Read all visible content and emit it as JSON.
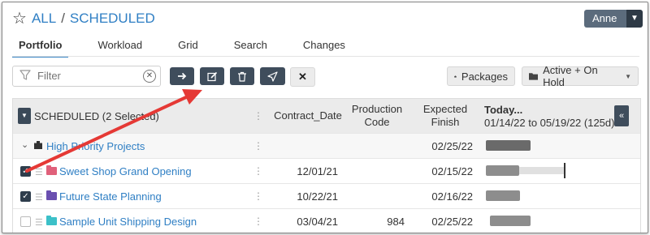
{
  "breadcrumb": {
    "root": "ALL",
    "separator": "/",
    "current": "SCHEDULED"
  },
  "user": {
    "name": "Anne"
  },
  "tabs": [
    "Portfolio",
    "Workload",
    "Grid",
    "Search",
    "Changes"
  ],
  "active_tab": "Portfolio",
  "filter": {
    "placeholder": "Filter"
  },
  "toolbar": {
    "buttons": [
      "move-arrow-icon",
      "edit-icon",
      "trash-icon",
      "send-icon",
      "close-icon"
    ],
    "packages_label": "Packages",
    "status_filter_label": "Active + On Hold"
  },
  "grid": {
    "selection_label": "SCHEDULED (2 Selected)",
    "headers": {
      "contract_date": "Contract_Date",
      "production_code_1": "Production",
      "production_code_2": "Code",
      "expected_finish_1": "Expected",
      "expected_finish_2": "Finish",
      "timeline_title": "Today...",
      "timeline_range": "01/14/22 to 05/19/22 (125d)"
    },
    "group": {
      "name": "High Priority Projects",
      "expected_finish": "02/25/22"
    },
    "rows": [
      {
        "name": "Sweet Shop Grand Opening",
        "contract_date": "12/01/21",
        "production_code": "",
        "expected_finish": "02/15/22",
        "checked": true,
        "folder_color": "#e0607a"
      },
      {
        "name": "Future State Planning",
        "contract_date": "10/22/21",
        "production_code": "",
        "expected_finish": "02/16/22",
        "checked": true,
        "folder_color": "#6a4fb0"
      },
      {
        "name": "Sample Unit Shipping Design",
        "contract_date": "03/04/21",
        "production_code": "984",
        "expected_finish": "02/25/22",
        "checked": false,
        "folder_color": "#3cc0c8"
      }
    ]
  },
  "colors": {
    "accent": "#2f7fc4",
    "dark_button": "#3f4d5c",
    "annotation_arrow": "#e53935"
  }
}
